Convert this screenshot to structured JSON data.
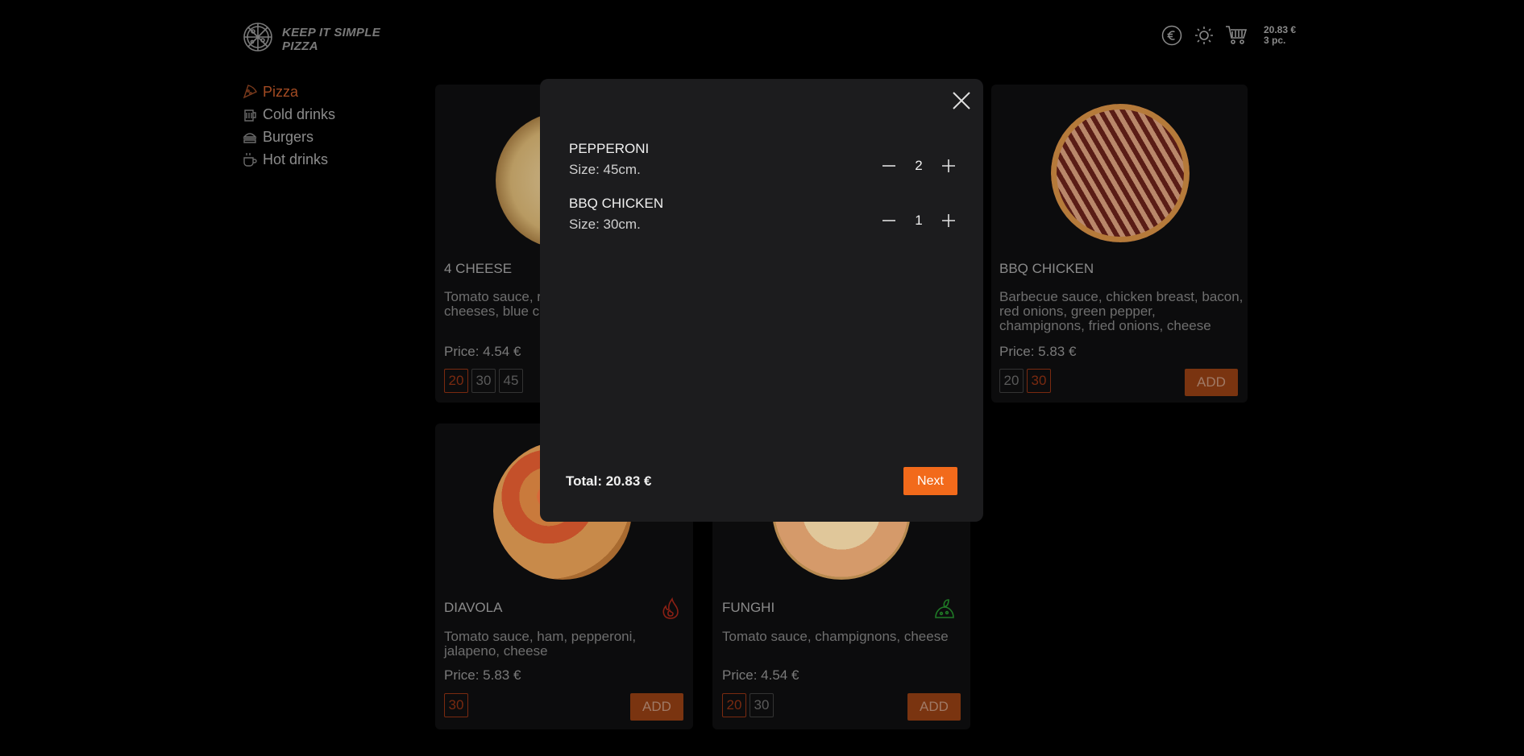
{
  "header": {
    "logo_line1": "KEEP IT SIMPLE",
    "logo_line2": "PIZZA",
    "cart_total": "20.83 €",
    "cart_count": "3 pc."
  },
  "sidebar": {
    "items": [
      {
        "label": "Pizza",
        "icon": "pizza-slice-icon",
        "active": true
      },
      {
        "label": "Cold drinks",
        "icon": "cold-drink-icon",
        "active": false
      },
      {
        "label": "Burgers",
        "icon": "burger-icon",
        "active": false
      },
      {
        "label": "Hot drinks",
        "icon": "hot-drink-icon",
        "active": false
      }
    ]
  },
  "cards": [
    {
      "title": "4 CHEESE",
      "desc1": "Tomato sauce, r",
      "desc2": "cheeses, blue ch",
      "price": "Price: 4.54 €",
      "sizes": [
        "20",
        "30",
        "45"
      ],
      "selected_size": "20"
    },
    {
      "title": "BBQ CHICKEN",
      "desc1": "Barbecue sauce, chicken breast, bacon,",
      "desc2": "red onions, green pepper,",
      "desc3": "champignons, fried onions, cheese",
      "price": "Price: 5.83 €",
      "sizes": [
        "20",
        "30"
      ],
      "selected_size": "30",
      "add_label": "ADD"
    },
    {
      "title": "DIAVOLA",
      "desc1": "Tomato sauce, ham, pepperoni,",
      "desc2": "jalapeno, cheese",
      "price": "Price: 5.83 €",
      "sizes": [
        "30"
      ],
      "selected_size": "30",
      "add_label": "ADD",
      "badge": "spicy-icon"
    },
    {
      "title": "FUNGHI",
      "desc1": "Tomato sauce, champignons, cheese",
      "price": "Price: 4.54 €",
      "sizes": [
        "20",
        "30"
      ],
      "selected_size": "20",
      "add_label": "ADD",
      "badge": "vegetarian-icon"
    }
  ],
  "modal": {
    "items": [
      {
        "name": "PEPPERONI",
        "size": "Size: 45cm.",
        "qty": "2"
      },
      {
        "name": "BBQ CHICKEN",
        "size": "Size: 30cm.",
        "qty": "1"
      }
    ],
    "total": "Total: 20.83 €",
    "next_label": "Next"
  },
  "colors": {
    "accent": "#f26a1b",
    "active_nav": "#a24a22",
    "modal_bg": "#1c1c1e"
  }
}
